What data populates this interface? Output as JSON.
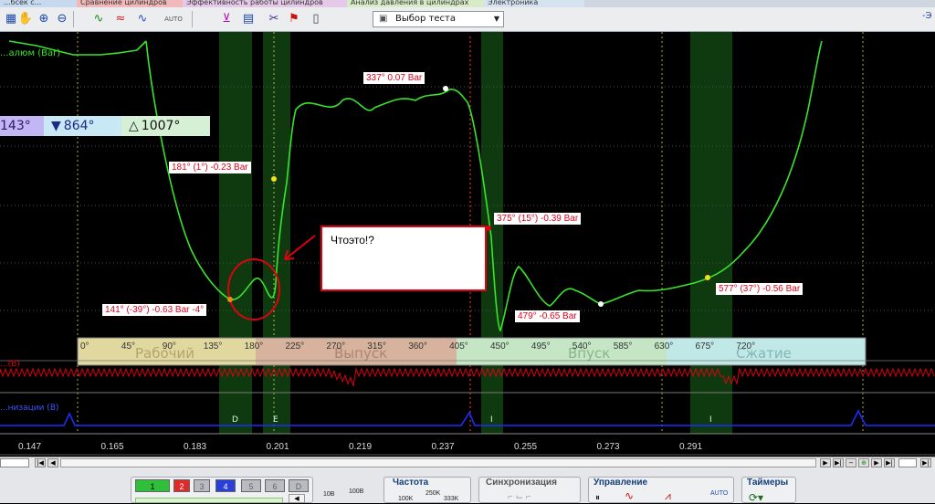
{
  "tabs": [
    {
      "label": "...бсек с...",
      "color": "#c7d9ef"
    },
    {
      "label": "Сравнение цилиндров",
      "color": "#f1b9b9"
    },
    {
      "label": "Эффективность работы цилиндров",
      "color": "#e6c9e9"
    },
    {
      "label": "Анализ давления в цилиндрах",
      "color": "#d7ecc6"
    },
    {
      "label": "Электроника",
      "color": "#d5e3f1"
    }
  ],
  "toolbar": {
    "test_select_value": "Выбор теста",
    "icons": [
      "grid-icon",
      "hand-icon",
      "zoom-icon",
      "zoom-out-icon",
      "wave-icon",
      "wave2-icon",
      "wave3-icon",
      "auto-icon",
      "marker-icon",
      "table-icon",
      "marker-scissors-icon",
      "flag-icon",
      "page-icon"
    ]
  },
  "plot": {
    "title": "...алюм (Bar)",
    "channel_label_2": "...(В)",
    "channel_label_3": "...низации (В)",
    "angle_bar": {
      "a": "143°",
      "b": "864°",
      "c": "1007°"
    },
    "x_ticks": [
      "0.147",
      "0.165",
      "0.183",
      "0.201",
      "0.219",
      "0.237",
      "0.255",
      "0.273",
      "0.291"
    ],
    "angle_ticks": [
      "0°",
      "45°",
      "90°",
      "135°",
      "180°",
      "225°",
      "270°",
      "315°",
      "360°",
      "405°",
      "450°",
      "495°",
      "540°",
      "585°",
      "630°",
      "675°",
      "720°"
    ],
    "phases": [
      "Рабочий",
      "Выпуск",
      "Впуск",
      "Сжатие"
    ],
    "event_letters": [
      "D",
      "E",
      "I",
      "I"
    ],
    "point_labels": [
      "337° 0.07 Bar",
      "181° (1°) -0.23 Bar",
      "375° (15°) -0.39 Bar",
      "141° (-39°) -0.63 Bar -4°",
      "479° -0.65 Bar",
      "577° (37°) -0.56 Bar"
    ],
    "annotation_text": "Чтоэто!?"
  },
  "bottom": {
    "channels": [
      {
        "label": "1",
        "color": "#2fbf3a"
      },
      {
        "label": "2",
        "color": "#e02a2a"
      },
      {
        "label": "3",
        "color": "#b8bcc2"
      },
      {
        "label": "4",
        "color": "#2a3fd8"
      },
      {
        "label": "5",
        "color": "#b8bcc2"
      },
      {
        "label": "6",
        "color": "#b8bcc2"
      },
      {
        "label": "D",
        "color": "#b8bcc2"
      }
    ],
    "volt_labels": [
      "10В",
      "100В"
    ],
    "freq_title": "Частота",
    "freq_values": [
      "100K",
      "250K",
      "333K"
    ],
    "sync_title": "Синхронизация",
    "control_title": "Управление",
    "timers_title": "Таймеры"
  },
  "colors": {
    "trace_green": "#38e52a",
    "zone_green": "#0f3a10",
    "red_trace": "#e00010",
    "blue_trace": "#1c2dff",
    "label_red": "#e0001a"
  }
}
